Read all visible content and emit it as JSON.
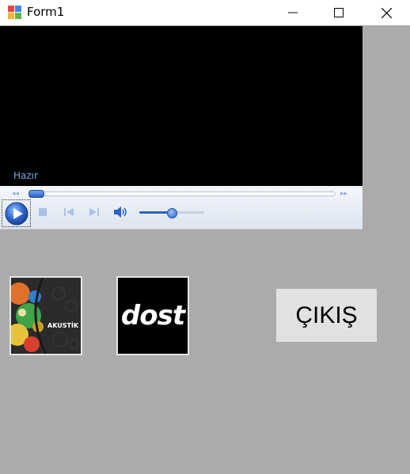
{
  "window": {
    "title": "Form1",
    "minimize_glyph": "—",
    "close_glyph": "✕"
  },
  "player": {
    "status": "Hazır",
    "volume_fraction": 0.5,
    "seek_fraction": 0.0
  },
  "thumbnails": [
    {
      "label": "AKUSTİK"
    },
    {
      "label": "dost"
    }
  ],
  "exit_button": {
    "label": "ÇIKIŞ"
  },
  "colors": {
    "form_bg": "#ababab",
    "video_bg": "#000000",
    "accent": "#2a62c8",
    "status_text": "#7aa8e8"
  }
}
